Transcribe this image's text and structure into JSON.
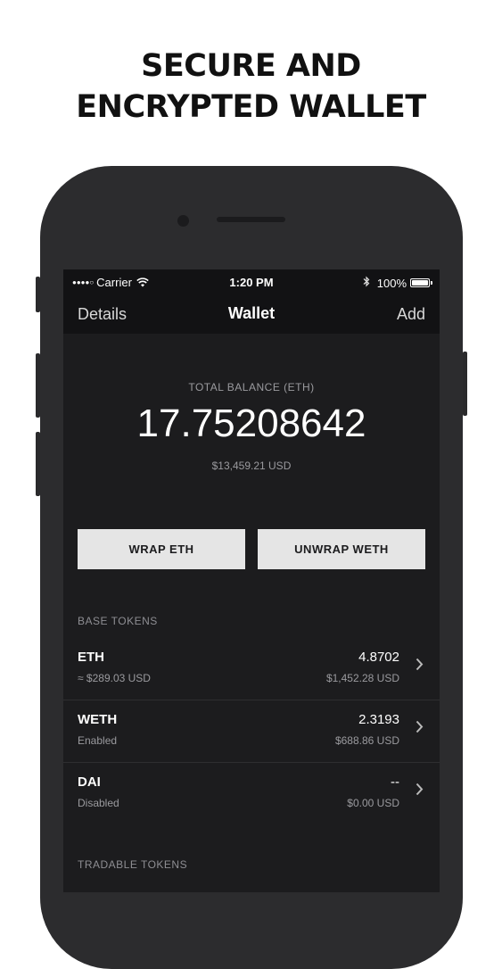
{
  "headline": {
    "line1": "SECURE AND",
    "line2": "ENCRYPTED WALLET"
  },
  "status_bar": {
    "carrier": "Carrier",
    "time": "1:20 PM",
    "battery": "100%",
    "icons": [
      "signal-dots-icon",
      "wifi-icon",
      "bluetooth-icon",
      "battery-icon"
    ]
  },
  "nav": {
    "left": "Details",
    "title": "Wallet",
    "right": "Add"
  },
  "balance": {
    "label": "TOTAL BALANCE (ETH)",
    "value": "17.75208642",
    "usd": "$13,459.21 USD"
  },
  "actions": {
    "wrap": "WRAP ETH",
    "unwrap": "UNWRAP WETH"
  },
  "sections": {
    "base": "BASE TOKENS",
    "tradable": "TRADABLE TOKENS"
  },
  "tokens": [
    {
      "symbol": "ETH",
      "sub": "≈ $289.03 USD",
      "amount": "4.8702",
      "usd": "$1,452.28 USD"
    },
    {
      "symbol": "WETH",
      "sub": "Enabled",
      "amount": "2.3193",
      "usd": "$688.86 USD"
    },
    {
      "symbol": "DAI",
      "sub": "Disabled",
      "amount": "--",
      "usd": "$0.00 USD"
    }
  ],
  "colors": {
    "background": "#ffffff",
    "phone": "#2c2c2e",
    "screen": "#1c1c1e",
    "button": "#e5e5e5"
  }
}
